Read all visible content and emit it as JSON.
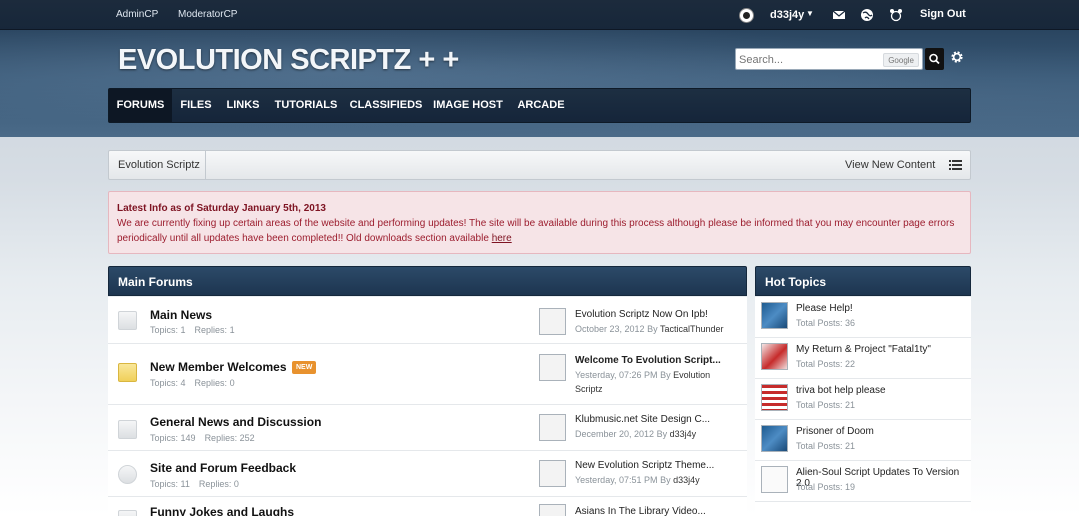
{
  "topbar": {
    "admin_label": "AdminCP",
    "moderator_label": "ModeratorCP",
    "username": "d33j4y",
    "caret": "▼",
    "signout_label": "Sign Out",
    "icons": [
      "user-avatar-icon",
      "mail-icon",
      "globe-icon",
      "notifications-icon"
    ]
  },
  "header": {
    "logo": "EVOLUTION SCRIPTZ + +",
    "search_placeholder": "Search...",
    "search_engine_label": "Google"
  },
  "nav": {
    "tabs": [
      "FORUMS",
      "FILES",
      "LINKS",
      "TUTORIALS",
      "CLASSIFIEDS",
      "IMAGE HOST",
      "ARCADE"
    ],
    "active": "FORUMS"
  },
  "breadcrumb": {
    "root": "Evolution Scriptz",
    "view_new": "View New Content"
  },
  "notice": {
    "title": "Latest Info as of Saturday January 5th, 2013",
    "body": "We are currently fixing up certain areas of the website and performing updates! The site will be available during this process although please be informed that you may encounter page errors periodically until all updates have been completed!! Old downloads section available ",
    "link": "here"
  },
  "main_forums": {
    "heading": "Main Forums",
    "topics_label": "Topics:",
    "replies_label": "Replies:",
    "by_label": "By",
    "rows": [
      {
        "name": "Main News",
        "badge": "",
        "topics": "1",
        "replies": "1",
        "last_title": "Evolution Scriptz Now On Ipb!",
        "last_date": "October 23, 2012",
        "last_by": "TacticalThunder"
      },
      {
        "name": "New Member Welcomes",
        "badge": "NEW",
        "topics": "4",
        "replies": "0",
        "last_title": "Welcome To Evolution Script...",
        "last_date": "Yesterday, 07:26 PM",
        "last_by": "Evolution Scriptz"
      },
      {
        "name": "General News and Discussion",
        "badge": "",
        "topics": "149",
        "replies": "252",
        "last_title": "Klubmusic.net Site Design C...",
        "last_date": "December 20, 2012",
        "last_by": "d33j4y"
      },
      {
        "name": "Site and Forum Feedback",
        "badge": "",
        "topics": "11",
        "replies": "0",
        "last_title": "New Evolution Scriptz Theme...",
        "last_date": "Yesterday, 07:51 PM",
        "last_by": "d33j4y"
      },
      {
        "name": "Funny Jokes and Laughs",
        "badge": "",
        "topics": "",
        "replies": "",
        "last_title": "Asians In The Library Video...",
        "last_date": "",
        "last_by": ""
      }
    ]
  },
  "hot_topics": {
    "heading": "Hot Topics",
    "posts_label": "Total Posts:",
    "rows": [
      {
        "title": "Please Help!",
        "posts": "36"
      },
      {
        "title": "My Return & Project \"Fatal1ty\"",
        "posts": "22"
      },
      {
        "title": "triva bot help please",
        "posts": "21"
      },
      {
        "title": "Prisoner of Doom",
        "posts": "21"
      },
      {
        "title": "Alien-Soul Script Updates To Version 2.0",
        "posts": "19"
      }
    ]
  }
}
